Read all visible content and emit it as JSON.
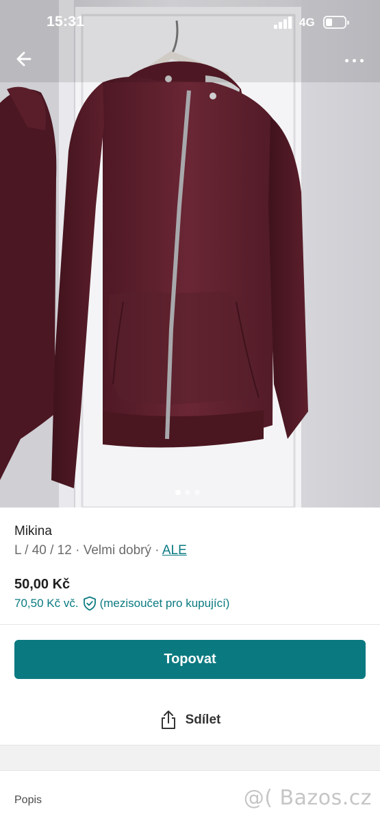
{
  "status_bar": {
    "time": "15:31",
    "network": "4G",
    "battery_level": 0.25
  },
  "navigation": {
    "back_icon": "arrow-left-icon",
    "more_icon": "more-horizontal-icon"
  },
  "gallery": {
    "image_count": 3,
    "current_index": 1
  },
  "item": {
    "title": "Mikina",
    "size": "L / 40 / 12",
    "separator": " · ",
    "condition": "Velmi dobrý",
    "brand": "ALE",
    "price": "50,00 Kč",
    "buyer_price": "70,50 Kč vč.",
    "buyer_price_note": "(mezisoučet pro kupující)",
    "protection_icon": "shield-check-icon"
  },
  "actions": {
    "promote_label": "Topovat",
    "share_label": "Sdílet",
    "share_icon": "share-icon"
  },
  "sections": {
    "description_label": "Popis"
  },
  "watermark": "@( Bazos.cz",
  "colors": {
    "accent": "#0b7a80",
    "garment": "#5c1f2c"
  }
}
